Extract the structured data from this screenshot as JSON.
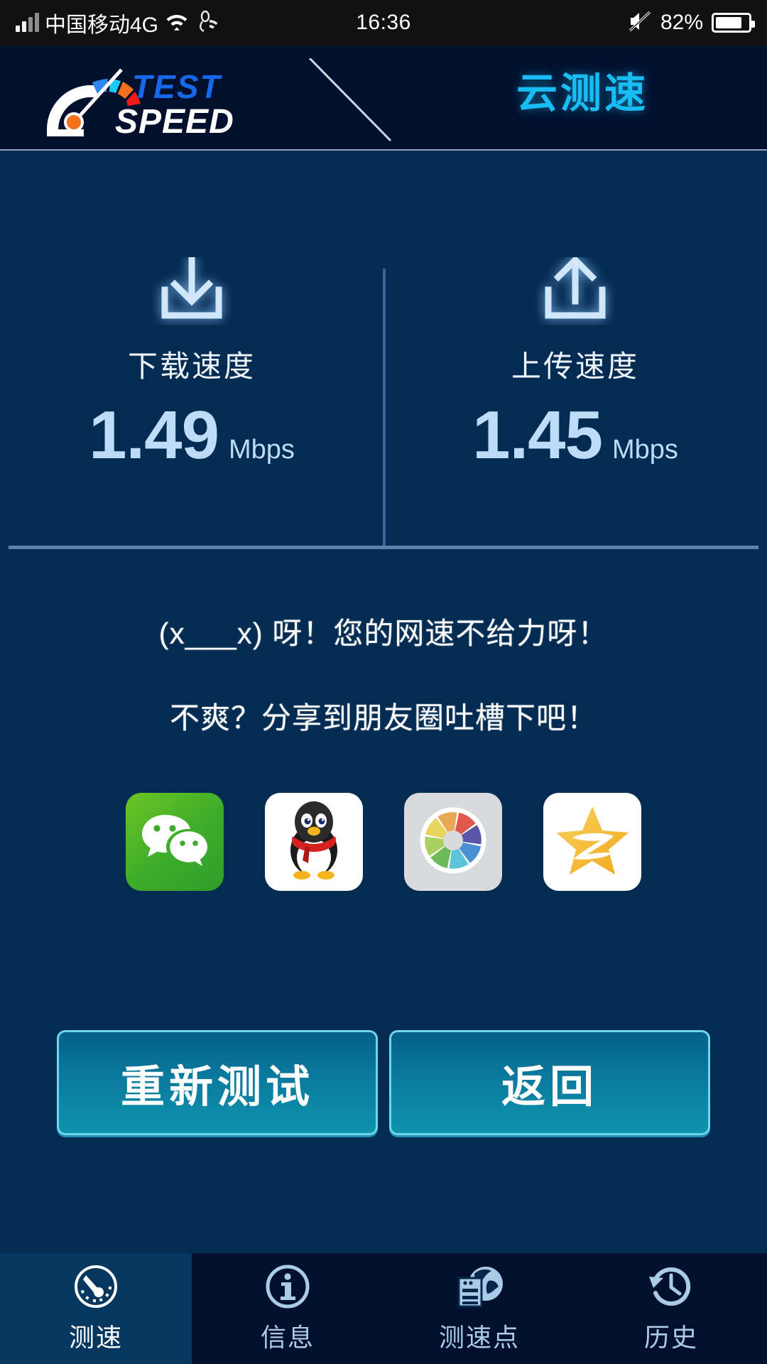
{
  "statusbar": {
    "carrier": "中国移动4G",
    "time": "16:36",
    "battery_percent": "82%",
    "signal_icon": "signal-bars-icon",
    "wifi_icon": "wifi-icon",
    "hotspot_icon": "hotspot-icon",
    "mute_icon": "mute-icon",
    "battery_icon": "battery-icon"
  },
  "header": {
    "logo_text_top": "TEST",
    "logo_text_bottom": "SPEED",
    "title": "云测速",
    "accent_color": "#18bdf5"
  },
  "results": {
    "download": {
      "icon": "download-arrow-icon",
      "label": "下载速度",
      "value": "1.49",
      "unit": "Mbps"
    },
    "upload": {
      "icon": "upload-arrow-icon",
      "label": "上传速度",
      "value": "1.45",
      "unit": "Mbps"
    }
  },
  "messages": {
    "line1": "(x___x) 呀！您的网速不给力呀！",
    "line2": "不爽？分享到朋友圈吐槽下吧！"
  },
  "share": [
    {
      "name": "wechat",
      "icon": "wechat-icon",
      "bg": "#3cab2a"
    },
    {
      "name": "qq",
      "icon": "qq-penguin-icon",
      "bg": "#ffffff"
    },
    {
      "name": "moments",
      "icon": "wechat-moments-icon",
      "bg": "#d9dadb"
    },
    {
      "name": "qzone",
      "icon": "qzone-star-icon",
      "bg": "#ffffff"
    }
  ],
  "actions": {
    "retest_label": "重新测试",
    "back_label": "返回"
  },
  "nav": {
    "items": [
      {
        "label": "测速",
        "icon": "speedometer-icon",
        "active": true
      },
      {
        "label": "信息",
        "icon": "info-circle-icon",
        "active": false
      },
      {
        "label": "测速点",
        "icon": "server-globe-icon",
        "active": false
      },
      {
        "label": "历史",
        "icon": "history-clock-icon",
        "active": false
      }
    ]
  },
  "colors": {
    "header_bg": "#02102e",
    "body_bg": "#042b52",
    "value_blue": "#bcdcf7",
    "button_border": "#6fd6ef"
  }
}
